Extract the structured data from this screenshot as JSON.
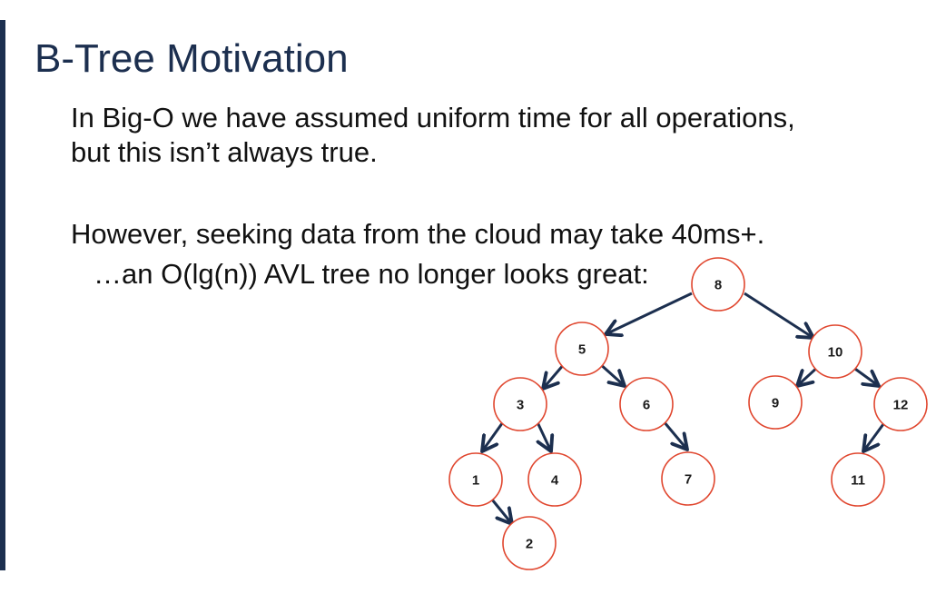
{
  "slide": {
    "title": "B-Tree Motivation",
    "lines": [
      "In Big-O we have assumed uniform time for all operations,",
      "but this isn’t always true.",
      "However, seeking data from the cloud may take 40ms+.",
      "…an O(lg(n)) AVL tree no longer looks great:"
    ]
  },
  "tree": {
    "nodes": [
      {
        "id": "n8",
        "label": "8"
      },
      {
        "id": "n5",
        "label": "5"
      },
      {
        "id": "n10",
        "label": "10"
      },
      {
        "id": "n3",
        "label": "3"
      },
      {
        "id": "n6",
        "label": "6"
      },
      {
        "id": "n9",
        "label": "9"
      },
      {
        "id": "n12",
        "label": "12"
      },
      {
        "id": "n1",
        "label": "1"
      },
      {
        "id": "n4",
        "label": "4"
      },
      {
        "id": "n7",
        "label": "7"
      },
      {
        "id": "n11",
        "label": "11"
      },
      {
        "id": "n2",
        "label": "2"
      }
    ],
    "edges": [
      [
        "n8",
        "n5"
      ],
      [
        "n8",
        "n10"
      ],
      [
        "n5",
        "n3"
      ],
      [
        "n5",
        "n6"
      ],
      [
        "n10",
        "n9"
      ],
      [
        "n10",
        "n12"
      ],
      [
        "n3",
        "n1"
      ],
      [
        "n3",
        "n4"
      ],
      [
        "n6",
        "n7"
      ],
      [
        "n12",
        "n11"
      ],
      [
        "n1",
        "n2"
      ]
    ]
  }
}
